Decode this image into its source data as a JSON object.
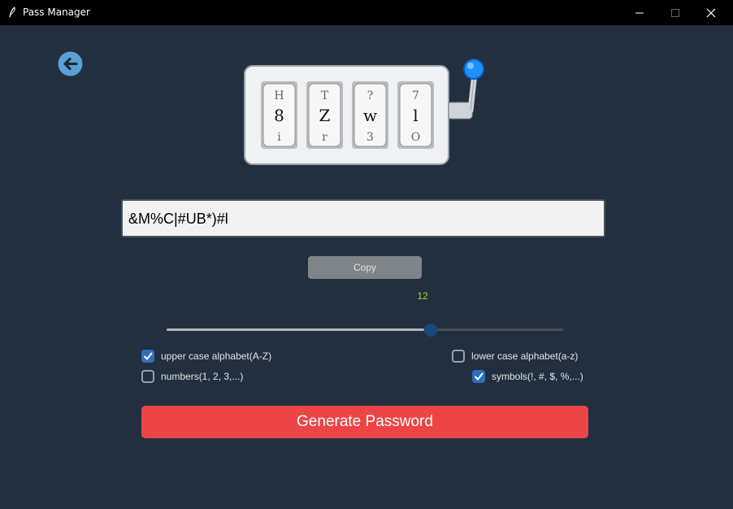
{
  "window": {
    "title": "Pass Manager",
    "controls": [
      "minimize",
      "maximize",
      "close"
    ]
  },
  "nav": {
    "back_icon": "arrow-left-icon"
  },
  "slot_machine": {
    "reels": [
      {
        "top": "H",
        "middle": "8",
        "bottom": "i"
      },
      {
        "top": "T",
        "middle": "Z",
        "bottom": "r"
      },
      {
        "top": "?",
        "middle": "w",
        "bottom": "3"
      },
      {
        "top": "7",
        "middle": "l",
        "bottom": "O"
      }
    ]
  },
  "password": {
    "value": "&M%C|#UB*)#l"
  },
  "copy_button": {
    "label": "Copy"
  },
  "length": {
    "value": "12",
    "fraction": 0.65
  },
  "options": {
    "upper": {
      "label": "upper case alphabet(A-Z)",
      "checked": true
    },
    "lower": {
      "label": "lower case alphabet(a-z)",
      "checked": false
    },
    "numbers": {
      "label": "numbers(1, 2, 3,...)",
      "checked": false
    },
    "symbols": {
      "label": "symbols(!, #, $, %,...)",
      "checked": true
    }
  },
  "generate_button": {
    "label": "Generate Password"
  },
  "colors": {
    "background": "#222f3e",
    "accent": "#ed4545",
    "checkbox_on": "#2f6fbd",
    "length_text": "#b5d63a"
  }
}
